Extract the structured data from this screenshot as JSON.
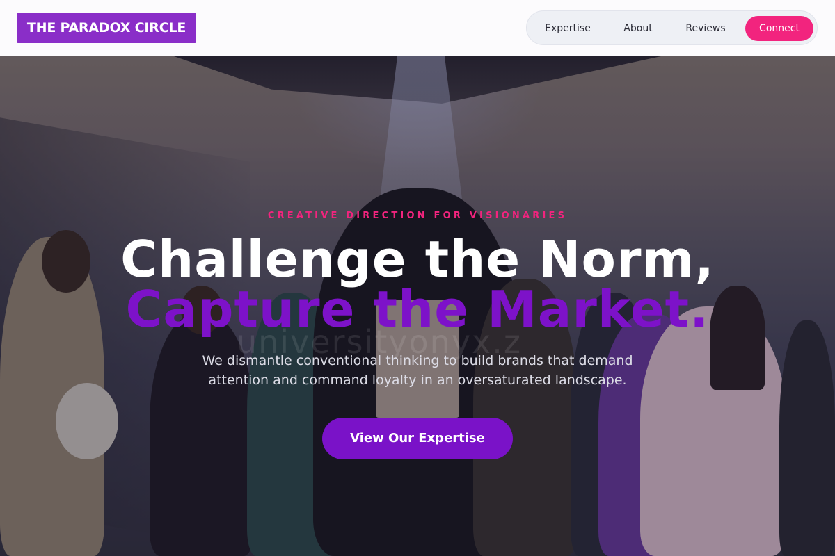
{
  "brand": {
    "name": "THE PARADOX CIRCLE"
  },
  "nav": {
    "items": [
      {
        "label": "Expertise"
      },
      {
        "label": "About"
      },
      {
        "label": "Reviews"
      },
      {
        "label": "Connect"
      }
    ]
  },
  "hero": {
    "eyebrow": "CREATIVE DIRECTION FOR VISIONARIES",
    "title_line1": "Challenge the Norm,",
    "title_line2": "Capture the Market.",
    "subtitle": "We dismantle conventional thinking to build brands that demand attention and command loyalty in an oversaturated landscape.",
    "cta_label": "View Our Expertise",
    "background_image": "fashion-group-photo",
    "watermark": "universityonyx.z"
  },
  "colors": {
    "brand_purple": "#8a2ec8",
    "accent_pink": "#f2247e",
    "title_purple": "#7d12c9",
    "cta_purple": "#7a12c8"
  }
}
